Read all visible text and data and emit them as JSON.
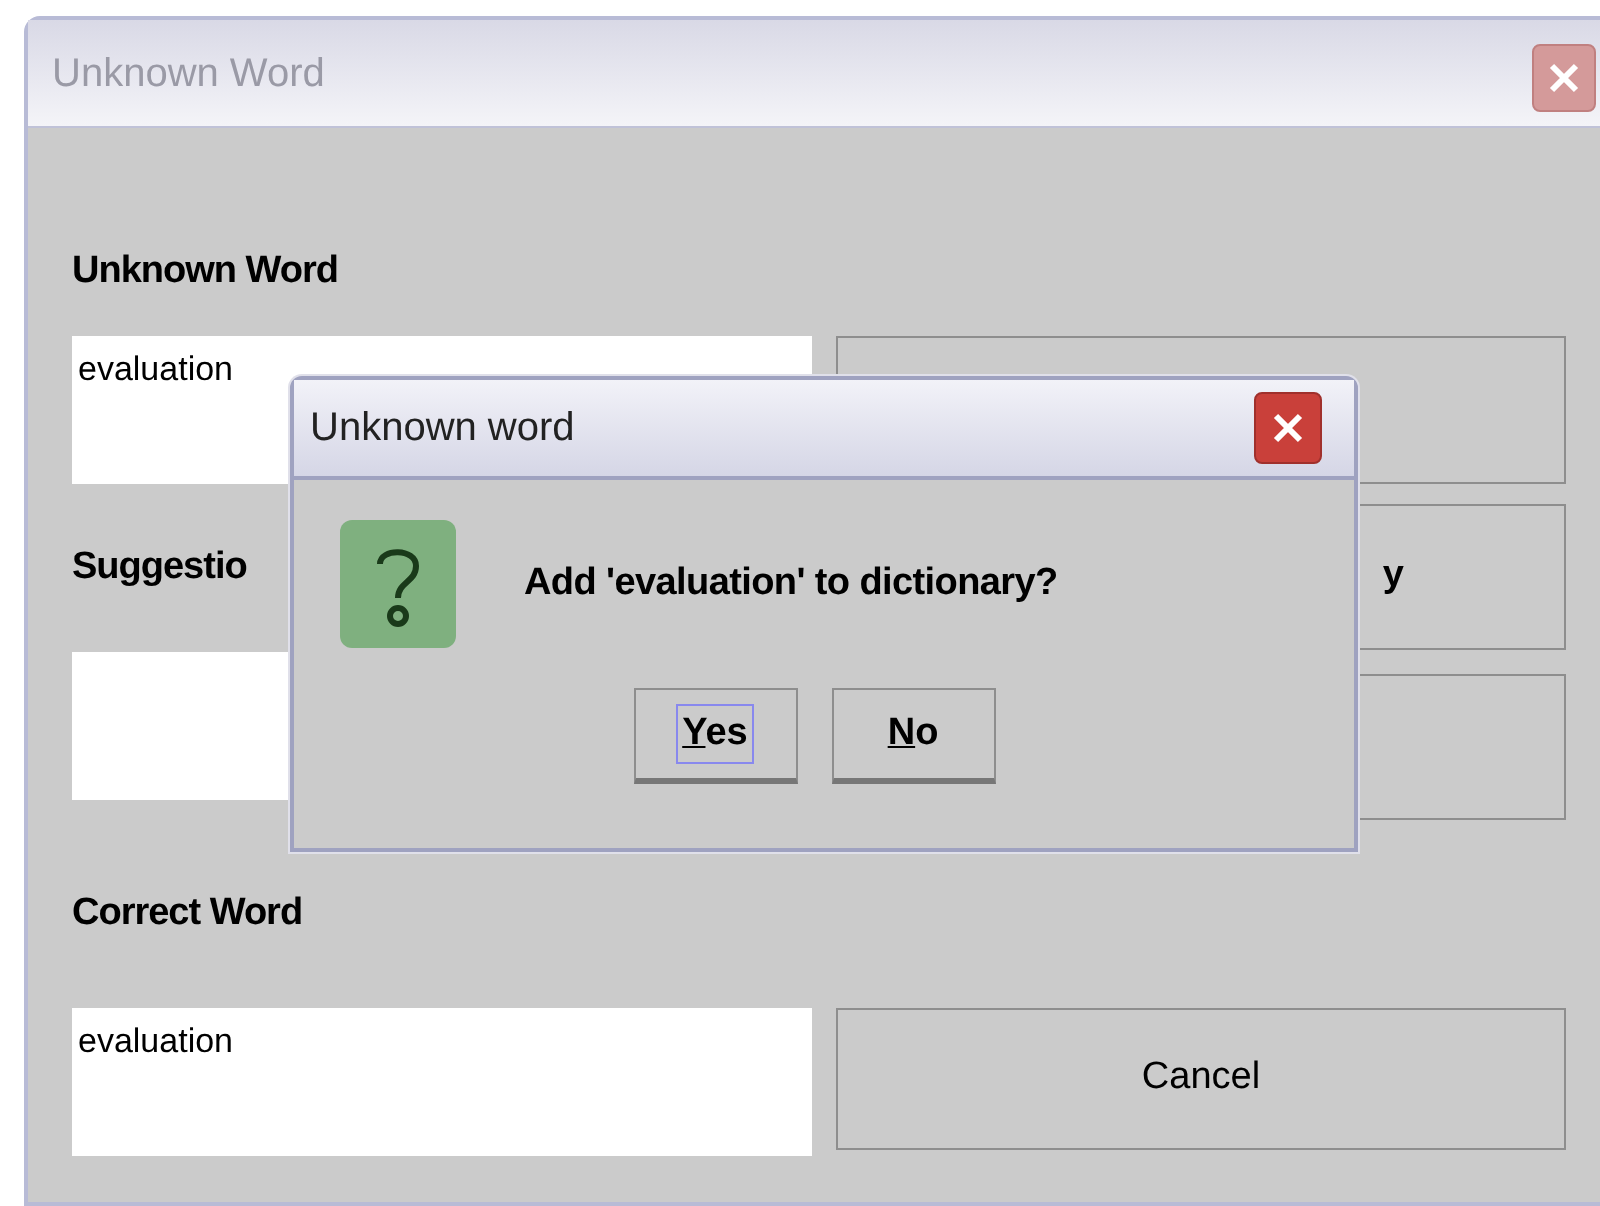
{
  "window": {
    "title": "Unknown Word"
  },
  "unknown_word": {
    "label": "Unknown Word",
    "value": "evaluation"
  },
  "suggestions": {
    "label": "Suggestio"
  },
  "dictionary_button": {
    "label": "y"
  },
  "correct_word": {
    "label": "Correct Word",
    "value": "evaluation"
  },
  "cancel_button": {
    "label": "Cancel"
  },
  "dialog": {
    "title": "Unknown word",
    "message": "Add 'evaluation' to dictionary?",
    "buttons": [
      {
        "label": "Yes",
        "focused": true
      },
      {
        "label": "No",
        "focused": false
      }
    ]
  }
}
